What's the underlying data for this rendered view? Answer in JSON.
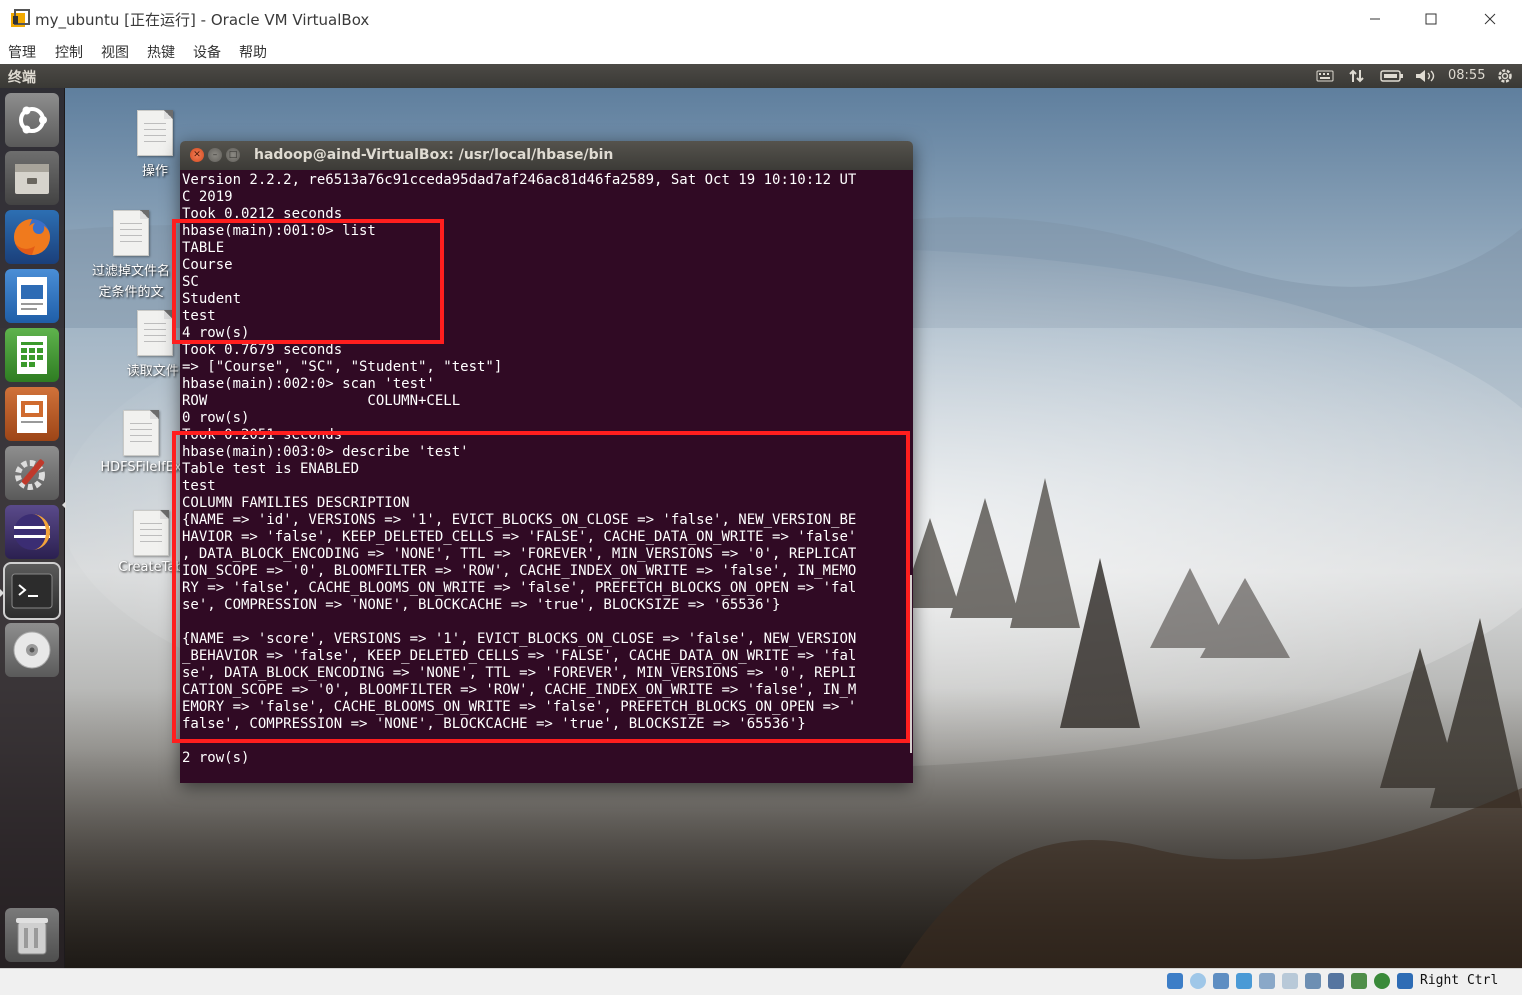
{
  "vbox": {
    "title": "my_ubuntu [正在运行] - Oracle VM VirtualBox",
    "menu": [
      "管理",
      "控制",
      "视图",
      "热键",
      "设备",
      "帮助"
    ],
    "status_host_key": "Right Ctrl"
  },
  "ubuntu": {
    "app_name": "终端",
    "clock": "08:55",
    "indicators": [
      "keyboard-icon",
      "network-icon",
      "battery-icon",
      "volume-icon",
      "settings-gear-icon"
    ]
  },
  "launcher": [
    "ubuntu-dash-icon",
    "files-icon",
    "firefox-icon",
    "writer-icon",
    "calc-icon",
    "impress-icon",
    "system-settings-icon",
    "eclipse-icon",
    "terminal-icon",
    "dvd-icon",
    "trash-icon"
  ],
  "desktop_icons": [
    {
      "label": "操作"
    },
    {
      "label": "过滤掉文件名",
      "label2": "定条件的文"
    },
    {
      "label": "读取文件:"
    },
    {
      "label": "HDFSFileIfEx"
    },
    {
      "label": "CreateTab"
    }
  ],
  "terminal": {
    "title": "hadoop@aind-VirtualBox: /usr/local/hbase/bin",
    "lines": [
      "Version 2.2.2, re6513a76c91cceda95dad7af246ac81d46fa2589, Sat Oct 19 10:10:12 UT",
      "C 2019",
      "Took 0.0212 seconds",
      "hbase(main):001:0> list",
      "TABLE",
      "Course",
      "SC",
      "Student",
      "test",
      "4 row(s)",
      "Took 0.7679 seconds",
      "=> [\"Course\", \"SC\", \"Student\", \"test\"]",
      "hbase(main):002:0> scan 'test'",
      "ROW                   COLUMN+CELL",
      "0 row(s)",
      "Took 0.2051 seconds",
      "hbase(main):003:0> describe 'test'",
      "Table test is ENABLED",
      "test",
      "COLUMN FAMILIES DESCRIPTION",
      "{NAME => 'id', VERSIONS => '1', EVICT_BLOCKS_ON_CLOSE => 'false', NEW_VERSION_BE",
      "HAVIOR => 'false', KEEP_DELETED_CELLS => 'FALSE', CACHE_DATA_ON_WRITE => 'false'",
      ", DATA_BLOCK_ENCODING => 'NONE', TTL => 'FOREVER', MIN_VERSIONS => '0', REPLICAT",
      "ION_SCOPE => '0', BLOOMFILTER => 'ROW', CACHE_INDEX_ON_WRITE => 'false', IN_MEMO",
      "RY => 'false', CACHE_BLOOMS_ON_WRITE => 'false', PREFETCH_BLOCKS_ON_OPEN => 'fal",
      "se', COMPRESSION => 'NONE', BLOCKCACHE => 'true', BLOCKSIZE => '65536'}",
      "",
      "{NAME => 'score', VERSIONS => '1', EVICT_BLOCKS_ON_CLOSE => 'false', NEW_VERSION",
      "_BEHAVIOR => 'false', KEEP_DELETED_CELLS => 'FALSE', CACHE_DATA_ON_WRITE => 'fal",
      "se', DATA_BLOCK_ENCODING => 'NONE', TTL => 'FOREVER', MIN_VERSIONS => '0', REPLI",
      "CATION_SCOPE => '0', BLOOMFILTER => 'ROW', CACHE_INDEX_ON_WRITE => 'false', IN_M",
      "EMORY => 'false', CACHE_BLOOMS_ON_WRITE => 'false', PREFETCH_BLOCKS_ON_OPEN => '",
      "false', COMPRESSION => 'NONE', BLOCKCACHE => 'true', BLOCKSIZE => '65536'}",
      "",
      "2 row(s)"
    ]
  },
  "colors": {
    "terminal_bg": "#300a24",
    "highlight": "#ff1e1e"
  }
}
